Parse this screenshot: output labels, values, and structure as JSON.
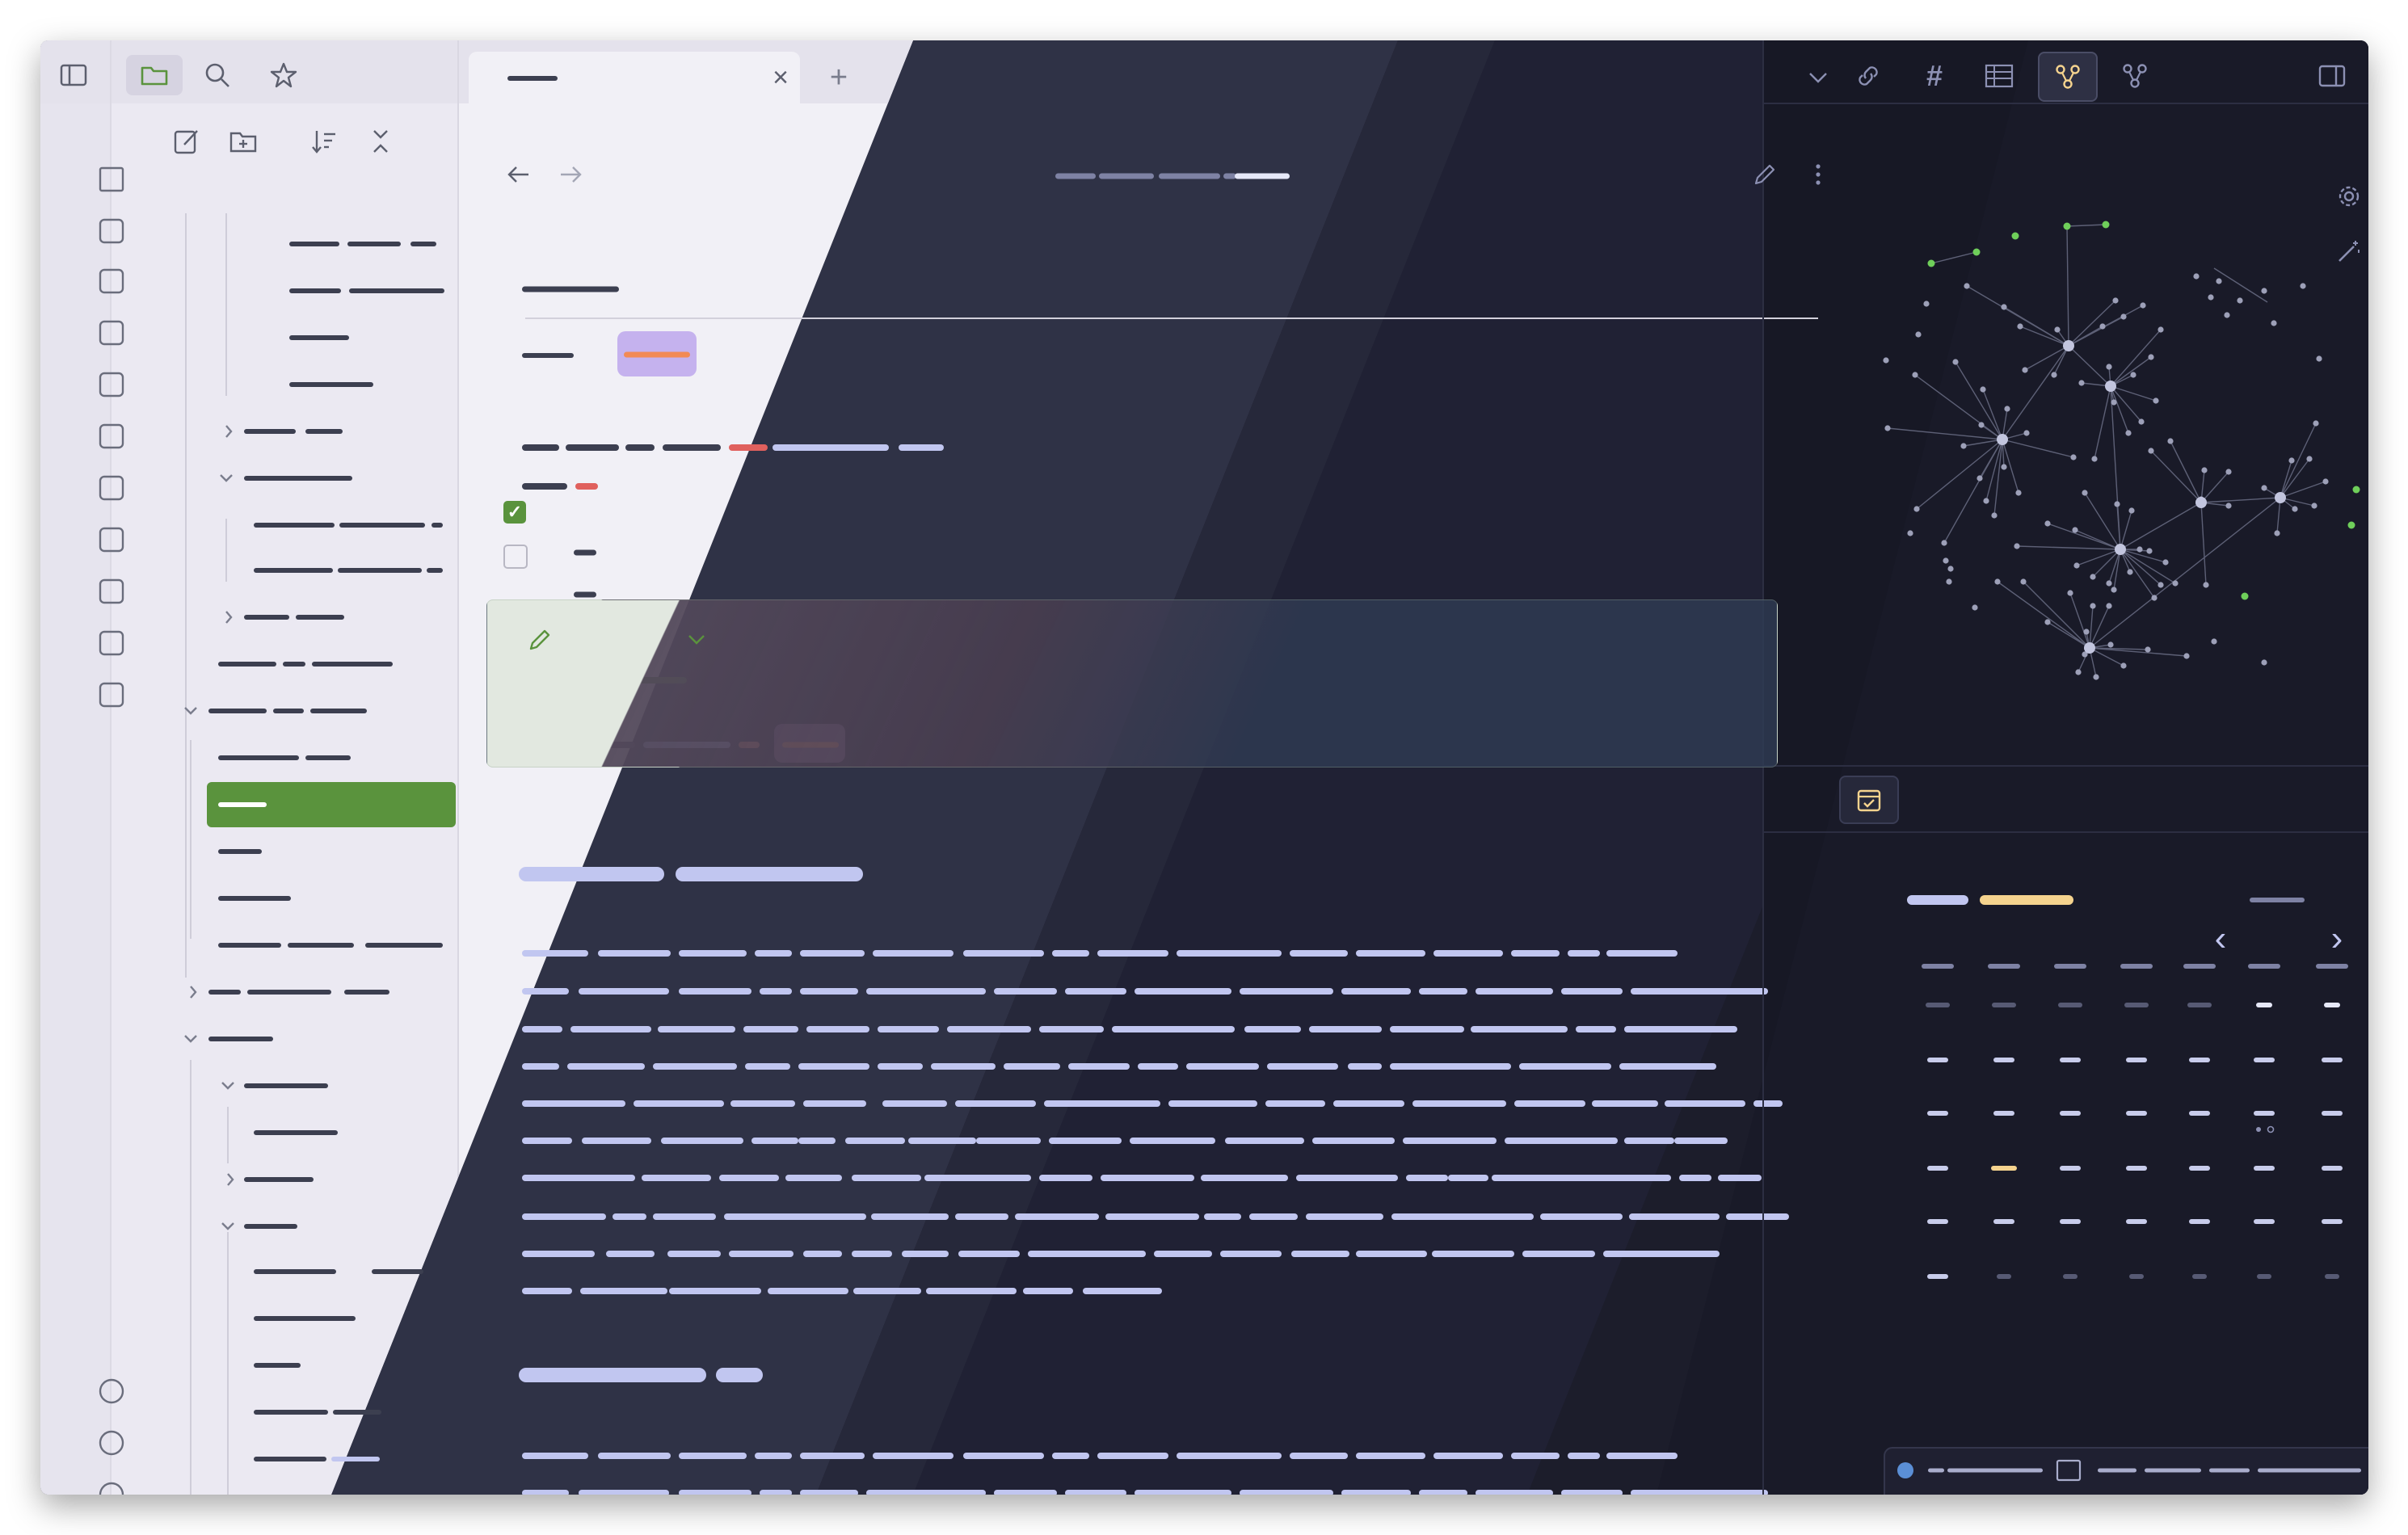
{
  "theme_colors": {
    "light_bg": "#f1f0f6",
    "dark_bg": "#1c1d2b",
    "accent_green": "#5a933d",
    "tag_purple": "#c5b2ee",
    "highlight_orange": "#f28a55",
    "dark_text_bar": "#c1c6f0",
    "calendar_today": "#f5d38e"
  },
  "left_rail": {
    "top_icons": [
      "sidebar-toggle-icon",
      "files-icon",
      "search-icon",
      "bookmarks-icon"
    ],
    "ribbon_icons": [
      "home-icon",
      "templater-icon",
      "table-icon",
      "emoji-icon",
      "pin-icon",
      "find-file-icon",
      "graph-icon",
      "copy-icon",
      "terminal-icon",
      "layout-icon",
      "calendar-day-icon"
    ],
    "bottom_icons": [
      "vault-icon",
      "help-icon",
      "settings-icon"
    ]
  },
  "file_explorer": {
    "toolbar_icons": [
      "new-note-icon",
      "new-folder-icon",
      "sort-icon",
      "collapse-icon"
    ]
  },
  "tab": {
    "new_tab": "+",
    "close": "×"
  },
  "right_panel": {
    "top_icons": [
      "outgoing-links-icon",
      "tags-icon",
      "table-view-icon",
      "graph-view-icon",
      "local-graph-icon",
      "right-sidebar-toggle-icon"
    ],
    "graph_controls": [
      "settings-icon",
      "magic-wand-icon"
    ],
    "calendar_tab_icon": "calendar-check-icon",
    "calendar_prev": "‹",
    "calendar_next": "›",
    "status_icons": [
      "globe-icon",
      "book-icon"
    ]
  },
  "editor": {
    "nav_icons": [
      "back-arrow-icon",
      "forward-arrow-icon"
    ],
    "action_icons": [
      "edit-icon",
      "more-options-icon"
    ],
    "checkbox_checked": "✓"
  }
}
